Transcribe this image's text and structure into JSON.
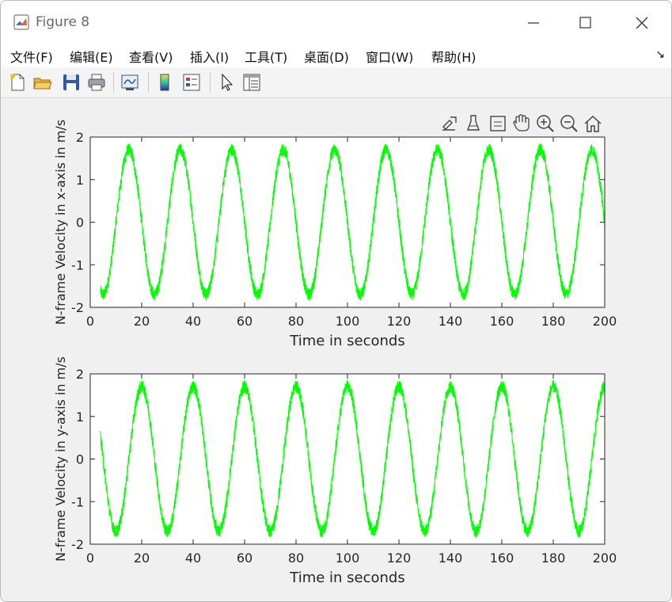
{
  "window": {
    "title": "Figure 8"
  },
  "menu": [
    "文件(F)",
    "编辑(E)",
    "查看(V)",
    "插入(I)",
    "工具(T)",
    "桌面(D)",
    "窗口(W)",
    "帮助(H)"
  ],
  "colors": {
    "line": "#00ff00",
    "axes_bg": "#ffffff",
    "figure_bg": "#f0f0f0"
  },
  "chart_data": [
    {
      "type": "line",
      "xlabel": "Time in seconds",
      "ylabel": "N-frame Velocity in x-axis in m/s",
      "xlim": [
        0,
        200
      ],
      "ylim": [
        -2,
        2
      ],
      "xticks": [
        "0",
        "20",
        "40",
        "60",
        "80",
        "100",
        "120",
        "140",
        "160",
        "180",
        "200"
      ],
      "yticks": [
        "-2",
        "-1",
        "0",
        "1",
        "2"
      ],
      "grid": false,
      "series": [
        {
          "x_start": 4,
          "x_end": 200,
          "amplitude": 1.7,
          "period": 20,
          "noise": 0.15,
          "peaks_at": [
            15,
            35,
            55,
            75,
            95,
            115,
            135,
            155,
            175,
            195
          ],
          "troughs_at": [
            5,
            25,
            45,
            65,
            85,
            105,
            125,
            145,
            165,
            185
          ]
        }
      ]
    },
    {
      "type": "line",
      "xlabel": "Time in seconds",
      "ylabel": "N-frame Velocity in y-axis in m/s",
      "xlim": [
        0,
        200
      ],
      "ylim": [
        -2,
        2
      ],
      "xticks": [
        "0",
        "20",
        "40",
        "60",
        "80",
        "100",
        "120",
        "140",
        "160",
        "180",
        "200"
      ],
      "yticks": [
        "-2",
        "-1",
        "0",
        "1",
        "2"
      ],
      "grid": false,
      "series": [
        {
          "x_start": 4,
          "x_end": 200,
          "amplitude": 1.7,
          "period": 20,
          "noise": 0.15,
          "peaks_at": [
            20,
            40,
            60,
            80,
            100,
            120,
            140,
            160,
            180,
            200
          ],
          "troughs_at": [
            10,
            30,
            50,
            70,
            90,
            110,
            130,
            150,
            170,
            190
          ]
        }
      ]
    }
  ]
}
